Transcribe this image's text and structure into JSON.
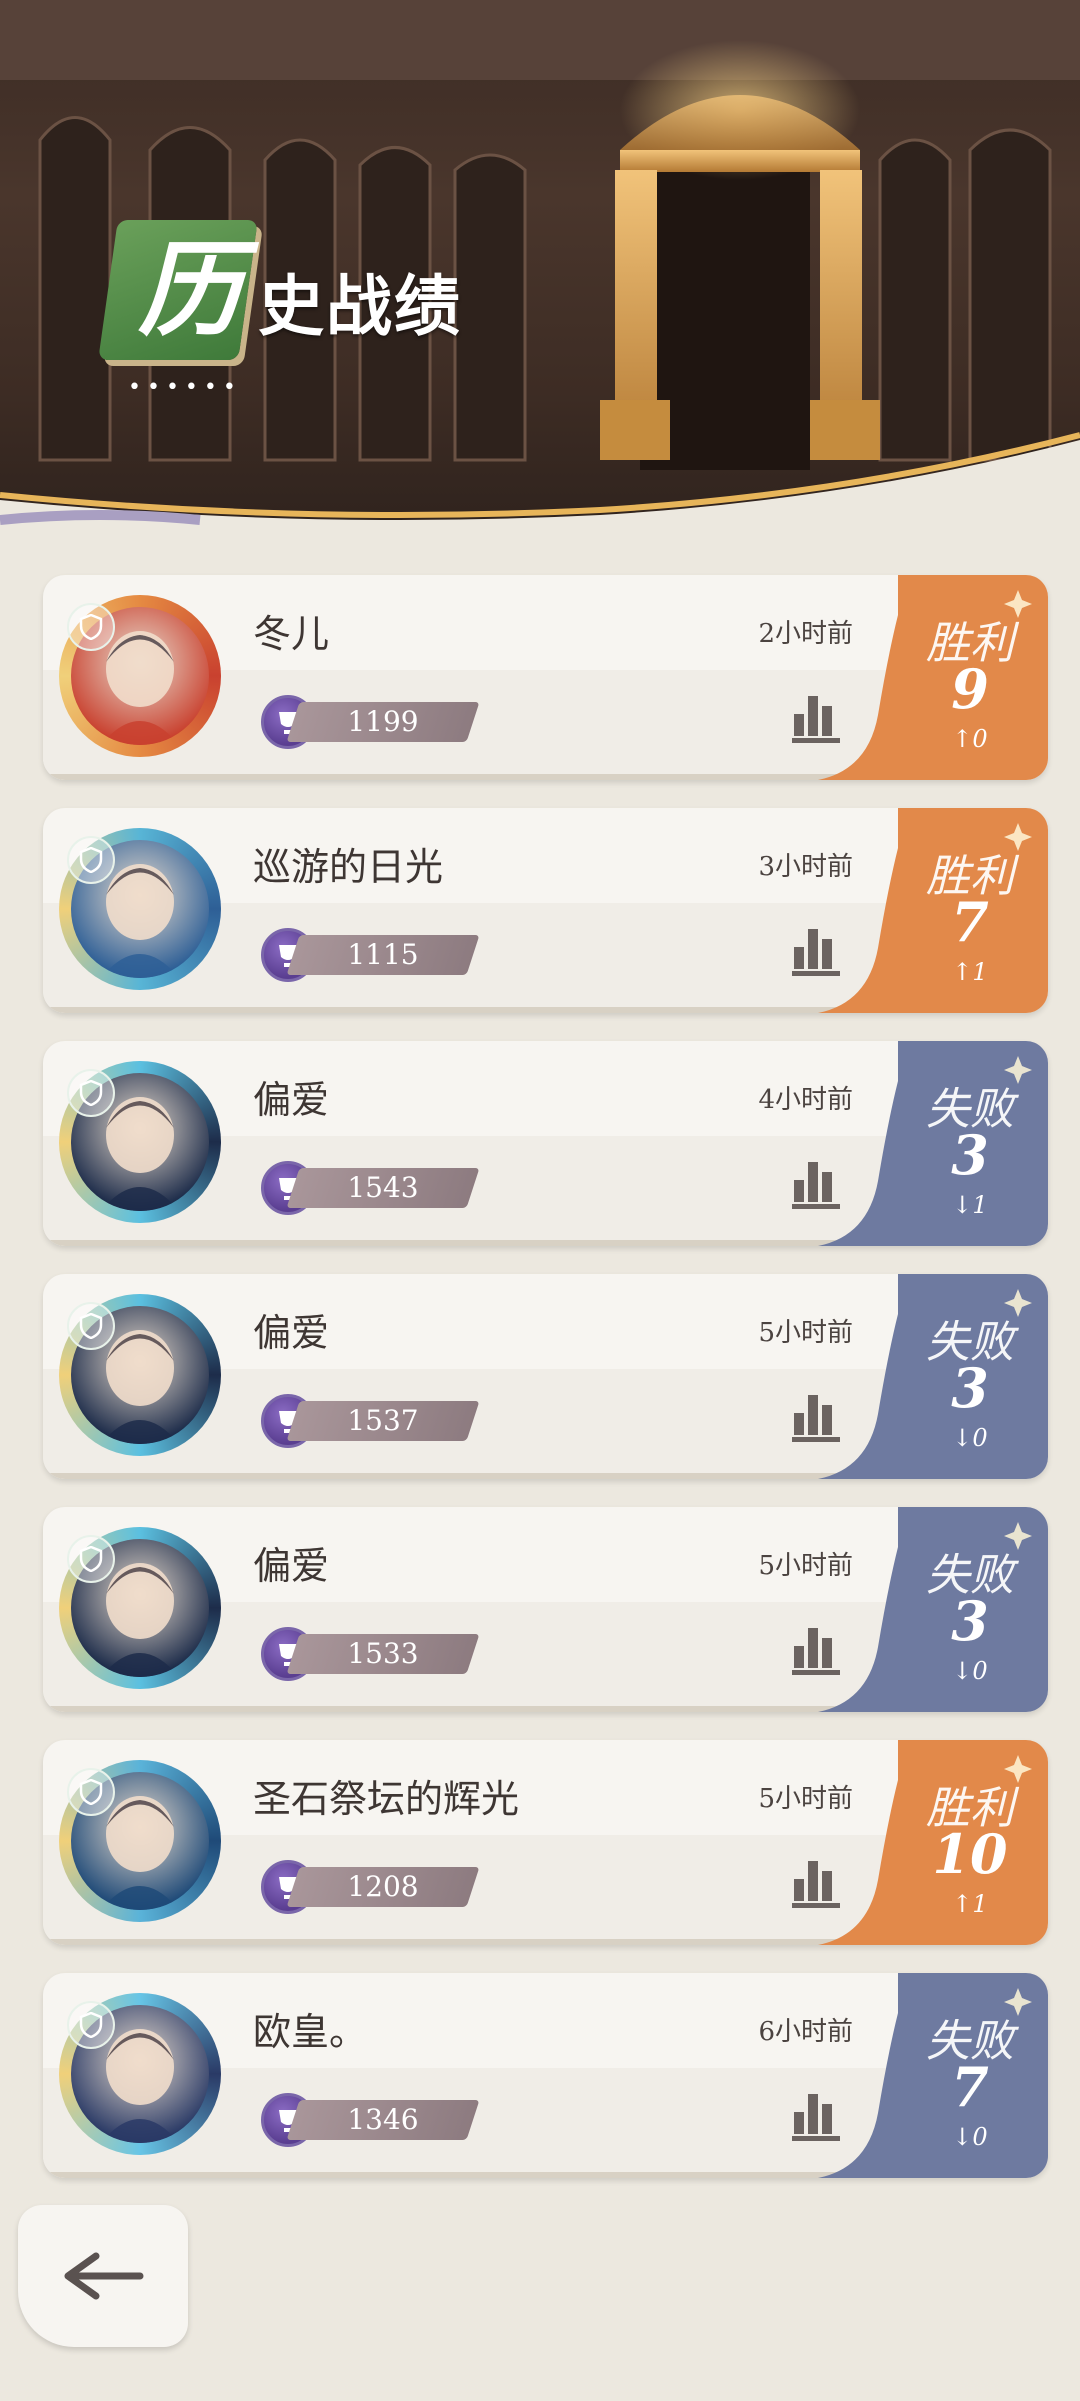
{
  "header": {
    "title_badge": "历",
    "title_rest": "史战绩",
    "dots": "••••••"
  },
  "colors": {
    "win": "#e2894a",
    "loss": "#6e7aa0"
  },
  "records": [
    {
      "name": "冬儿",
      "time": "2小时前",
      "score": "1199",
      "result": "胜利",
      "count": "9",
      "delta": "↑0",
      "outcome": "win",
      "avatar": "cat"
    },
    {
      "name": "巡游的日光",
      "time": "3小时前",
      "score": "1115",
      "result": "胜利",
      "count": "7",
      "delta": "↑1",
      "outcome": "win",
      "avatar": "anime-silver"
    },
    {
      "name": "偏爱",
      "time": "4小时前",
      "score": "1543",
      "result": "失败",
      "count": "3",
      "delta": "↓1",
      "outcome": "loss",
      "avatar": "anime-dark"
    },
    {
      "name": "偏爱",
      "time": "5小时前",
      "score": "1537",
      "result": "失败",
      "count": "3",
      "delta": "↓0",
      "outcome": "loss",
      "avatar": "anime-dark"
    },
    {
      "name": "偏爱",
      "time": "5小时前",
      "score": "1533",
      "result": "失败",
      "count": "3",
      "delta": "↓0",
      "outcome": "loss",
      "avatar": "anime-dark"
    },
    {
      "name": "圣石祭坛的辉光",
      "time": "5小时前",
      "score": "1208",
      "result": "胜利",
      "count": "10",
      "delta": "↑1",
      "outcome": "win",
      "avatar": "anime-hat"
    },
    {
      "name": "欧皇。",
      "time": "6小时前",
      "score": "1346",
      "result": "失败",
      "count": "7",
      "delta": "↓0",
      "outcome": "loss",
      "avatar": "character"
    }
  ],
  "icons": {
    "shield": "shield-icon",
    "trophy": "trophy-icon",
    "stats": "bar-chart-icon",
    "back": "back-arrow-icon"
  }
}
